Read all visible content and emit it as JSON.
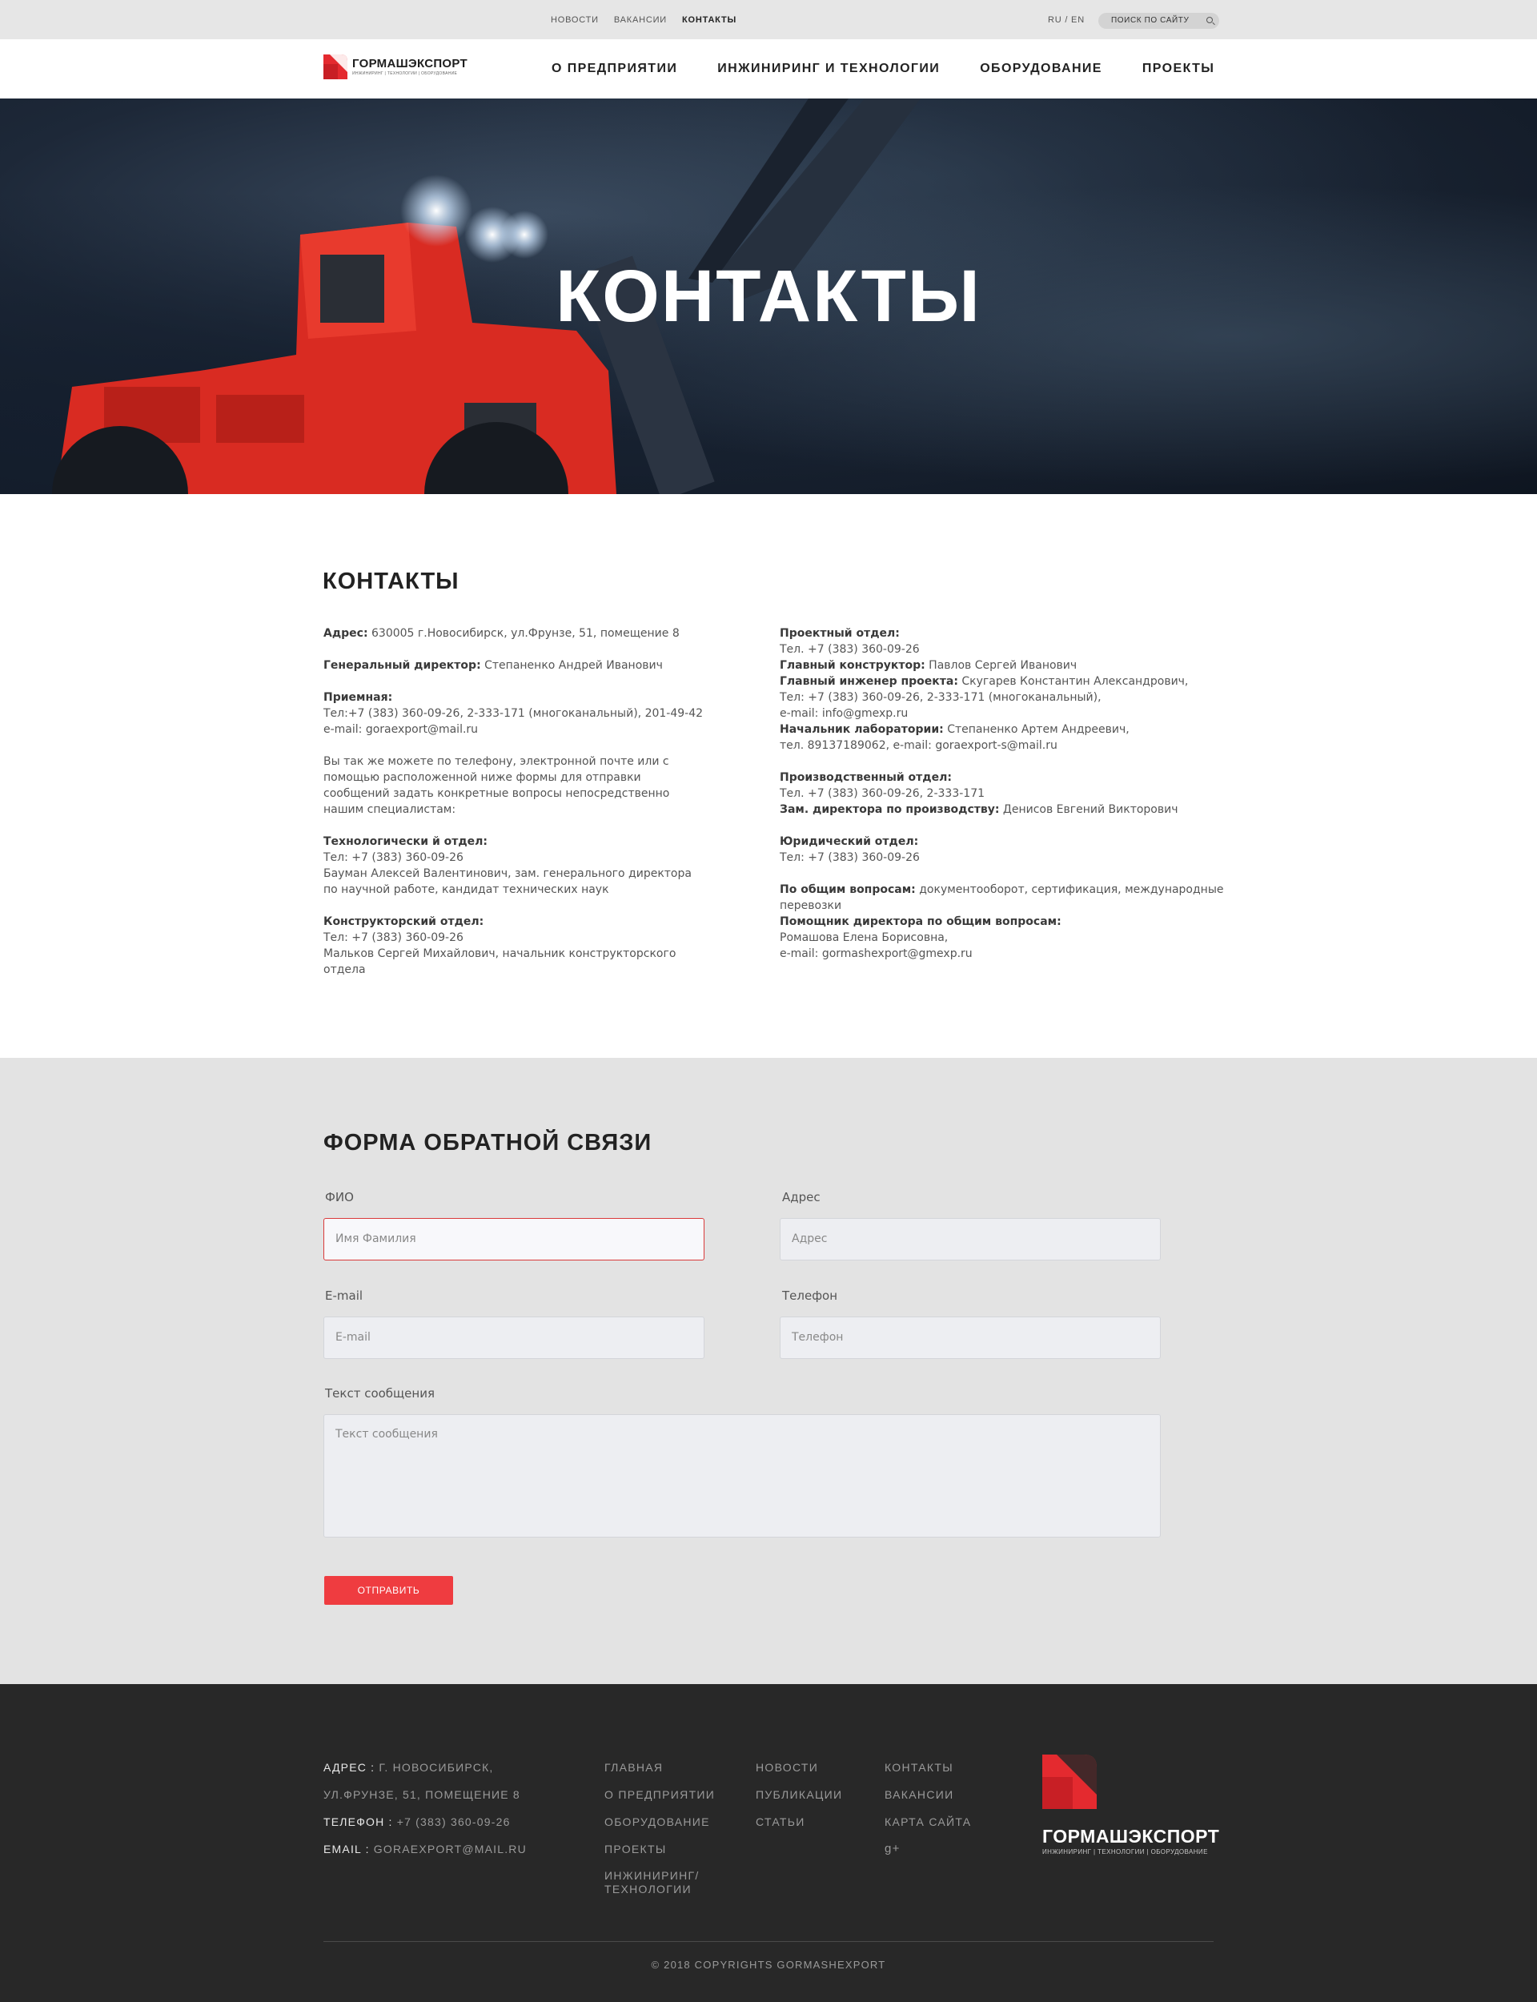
{
  "topbar": {
    "links": [
      {
        "label": "НОВОСТИ",
        "active": false
      },
      {
        "label": "ВАКАНСИИ",
        "active": false
      },
      {
        "label": "КОНТАКТЫ",
        "active": true
      }
    ],
    "lang": "RU / EN",
    "search_label": "ПОИСК ПО САЙТУ"
  },
  "header": {
    "logo_name": "ГОРМАШЭКСПОРТ",
    "logo_tagline": "ИНЖИНИРИНГ | ТЕХНОЛОГИИ | ОБОРУДОВАНИЕ",
    "nav": [
      "О ПРЕДПРИЯТИИ",
      "ИНЖИНИРИНГ И ТЕХНОЛОГИИ",
      "ОБОРУДОВАНИЕ",
      "ПРОЕКТЫ"
    ]
  },
  "hero": {
    "title": "КОНТАКТЫ"
  },
  "contacts": {
    "title": "КОНТАКТЫ",
    "address_label": "Адрес:",
    "address": "630005 г.Новосибирск, ул.Фрунзе, 51, помещение 8",
    "director_label": "Генеральный директор:",
    "director": "Степаненко Андрей Иванович",
    "reception_label": "Приемная:",
    "reception_phone": "Тел:+7 (383) 360-09-26, 2-333-171 (многоканальный), 201-49-42",
    "reception_email": "e-mail: goraexport@mail.ru",
    "intro": "Вы так же можете по телефону, электронной почте или с помощью расположенной ниже формы для отправки сообщений задать конкретные вопросы непосредственно нашим специалистам:",
    "tech_label": "Технологически й отдел:",
    "tech_phone": "Тел: +7 (383) 360-09-26",
    "tech_person": "Бауман Алексей Валентинович, зам. генерального директора по научной работе, кандидат технических наук",
    "design_label": "Конструкторский отдел:",
    "design_phone": "Тел: +7 (383) 360-09-26",
    "design_person": "Мальков Сергей Михайлович, начальник конструкторского отдела",
    "project_label": "Проектный отдел:",
    "project_phone": "Тел. +7 (383) 360-09-26",
    "chief_designer_label": "Главный конструктор:",
    "chief_designer": "Павлов Сергей Иванович",
    "chief_engineer_label": "Главный инженер проекта:",
    "chief_engineer": "Скугарев Константин Александрович,",
    "chief_engineer_phone": "Тел: +7 (383) 360-09-26, 2-333-171 (многоканальный),",
    "chief_engineer_email": "e-mail: info@gmexp.ru",
    "lab_label": "Начальник лаборатории:",
    "lab_head": "Степаненко Артем Андреевич,",
    "lab_contact": "тел. 89137189062, e-mail: goraexport-s@mail.ru",
    "production_label": "Производственный отдел:",
    "production_phone": "Тел. +7 (383) 360-09-26, 2-333-171",
    "production_deputy_label": "Зам. директора по производству:",
    "production_deputy": "Денисов Евгений Викторович",
    "legal_label": "Юридический отдел:",
    "legal_phone": "Тел: +7 (383) 360-09-26",
    "general_label": "По общим вопросам:",
    "general_text": "документооборот, сертификация, международные перевозки",
    "assistant_label": "Помощник директора по общим вопросам:",
    "assistant_name": "Ромашова Елена Борисовна,",
    "assistant_email": "e-mail: gormashexport@gmexp.ru"
  },
  "form": {
    "title": "ФОРМА ОБРАТНОЙ СВЯЗИ",
    "fio_label": "ФИО",
    "fio_placeholder": "Имя Фамилия",
    "address_label": "Адрес",
    "address_placeholder": "Адрес",
    "email_label": "E-mail",
    "email_placeholder": "E-mail",
    "phone_label": "Телефон",
    "phone_placeholder": "Телефон",
    "message_label": "Текст сообщения",
    "message_placeholder": "Текст сообщения",
    "submit_label": "ОТПРАВИТЬ"
  },
  "footer": {
    "address_label": "АДРЕС :",
    "address_line1": "Г. НОВОСИБИРСК,",
    "address_line2": "УЛ.ФРУНЗЕ, 51, ПОМЕЩЕНИЕ 8",
    "phone_label": "ТЕЛЕФОН :",
    "phone": "+7 (383) 360-09-26",
    "email_label": "EMAIL :",
    "email": "GORAEXPORT@MAIL.RU",
    "col1": [
      "ГЛАВНАЯ",
      "О ПРЕДПРИЯТИИ",
      "ОБОРУДОВАНИЕ",
      "ПРОЕКТЫ",
      "ИНЖИНИРИНГ/ ТЕХНОЛОГИИ"
    ],
    "col2": [
      "НОВОСТИ",
      "ПУБЛИКАЦИИ",
      "СТАТЬИ"
    ],
    "col3": [
      "КОНТАКТЫ",
      "ВАКАНСИИ",
      "КАРТА САЙТА"
    ],
    "gplus": "g+",
    "logo_name": "ГОРМАШЭКСПОРТ",
    "logo_tagline": "ИНЖИНИРИНГ | ТЕХНОЛОГИИ | ОБОРУДОВАНИЕ",
    "copyright": "© 2018 COPYRIGHTS GORMASHEXPORT"
  },
  "colors": {
    "accent": "#ef3c40",
    "footer_bg": "#282828",
    "form_bg": "#e3e3e3"
  }
}
